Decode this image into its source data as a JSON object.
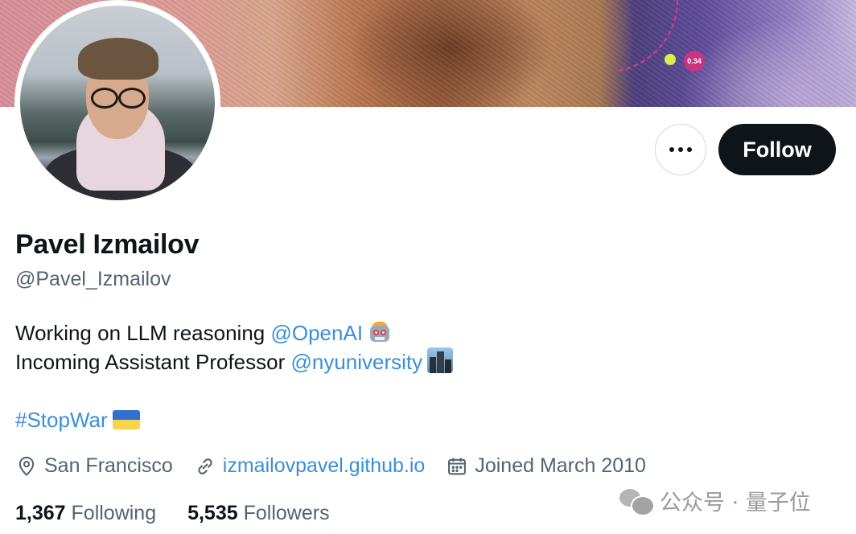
{
  "banner": {
    "badge_value": "0.34"
  },
  "profile": {
    "name": "Pavel Izmailov",
    "handle": "@Pavel_Izmailov",
    "avatar_alt": "Profile photo"
  },
  "actions": {
    "more_icon": "more-horizontal-icon",
    "follow_label": "Follow"
  },
  "bio": {
    "line1": {
      "text": "Working on LLM reasoning ",
      "mention": "@OpenAI",
      "emoji": "robot-emoji"
    },
    "line2": {
      "text": "Incoming Assistant Professor ",
      "mention": "@nyuniversity",
      "emoji": "night-city-emoji"
    },
    "line3": {
      "hashtag": "#StopWar",
      "emoji": "ukraine-flag-emoji"
    }
  },
  "meta": {
    "location": {
      "icon": "location-pin-icon",
      "text": "San Francisco"
    },
    "website": {
      "icon": "link-icon",
      "text": "izmailovpavel.github.io"
    },
    "joined": {
      "icon": "calendar-icon",
      "text": "Joined March 2010"
    }
  },
  "stats": {
    "following_count": "1,367",
    "following_label": "Following",
    "followers_count": "5,535",
    "followers_label": "Followers"
  },
  "watermark": {
    "text": "公众号 · 量子位"
  },
  "colors": {
    "link": "#3a8fd9",
    "text_primary": "#0f1419",
    "text_secondary": "#536471",
    "follow_bg": "#0f1419"
  }
}
